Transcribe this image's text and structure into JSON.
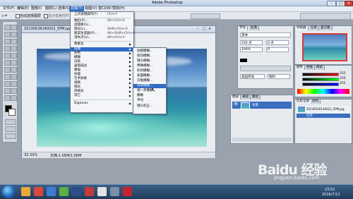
{
  "window": {
    "title": "Adobe Photoshop"
  },
  "menubar": {
    "items": [
      "文件(F)",
      "编辑(E)",
      "图像(I)",
      "图层(L)",
      "选择(S)",
      "滤镜(T)",
      "视图(V)",
      "窗口(W)",
      "帮助(H)"
    ]
  },
  "optionsbar": {
    "auto_select_label": "自动选择图层",
    "show_transform": "显示变换控件"
  },
  "document": {
    "title": "20130526140022_5PM.jpg @ 33.3% (RGB/8)",
    "zoom": "33.33%",
    "doc_info": "文档:1.05M/1.05M"
  },
  "filter_menu": {
    "items": [
      {
        "label": "上次滤镜操作(F)",
        "shortcut": "Ctrl+F"
      },
      {
        "label": "抽出(X)...",
        "shortcut": "Alt+Ctrl+X"
      },
      {
        "label": "滤镜库(G)...",
        "shortcut": ""
      },
      {
        "label": "液化(L)...",
        "shortcut": "Shift+Ctrl+X"
      },
      {
        "label": "图案生成器(P)...",
        "shortcut": "Alt+Shift+Ctrl+X"
      },
      {
        "label": "消失点(V)...",
        "shortcut": "Alt+Ctrl+V"
      },
      {
        "label": "像素化",
        "shortcut": ""
      },
      {
        "label": "扭曲",
        "shortcut": ""
      },
      {
        "label": "杂色",
        "shortcut": ""
      },
      {
        "label": "模糊",
        "shortcut": ""
      },
      {
        "label": "渲染",
        "shortcut": ""
      },
      {
        "label": "画笔描边",
        "shortcut": ""
      },
      {
        "label": "素描",
        "shortcut": ""
      },
      {
        "label": "纹理",
        "shortcut": ""
      },
      {
        "label": "艺术效果",
        "shortcut": ""
      },
      {
        "label": "视频",
        "shortcut": ""
      },
      {
        "label": "锐化",
        "shortcut": ""
      },
      {
        "label": "风格化",
        "shortcut": ""
      },
      {
        "label": "其它",
        "shortcut": ""
      },
      {
        "label": "Digimarc",
        "shortcut": ""
      }
    ]
  },
  "submenu": {
    "items": [
      "动感模糊...",
      "径向模糊...",
      "镜头模糊...",
      "特殊模糊...",
      "形状模糊...",
      "表面模糊...",
      "方框模糊...",
      "高斯模糊...",
      "进一步模糊",
      "模糊",
      "平均",
      "镜头校正..."
    ]
  },
  "panels": {
    "character_tabs": [
      "字符",
      "段落"
    ],
    "char_font": "黑体",
    "char_size": "100 点",
    "char_scale": "100%",
    "char_track": "0",
    "char_leading": "0 点",
    "char_lang": "美国英语",
    "char_aa": "锐利",
    "navigator_tabs": [
      "导航器",
      "信息",
      "直方图"
    ],
    "color_tabs": [
      "颜色",
      "色板",
      "样式"
    ],
    "color_values": [
      "255",
      "255",
      "255"
    ],
    "layers_tabs": [
      "图层",
      "通道",
      "路径"
    ],
    "layer_name": "背景",
    "history_tabs": [
      "历史记录",
      "动作"
    ],
    "history_items": [
      "20130526140022_5PM.jpg",
      "打开"
    ]
  },
  "watermark": {
    "brand": "Baidu 经验",
    "url": "jingyan.baidu.com"
  },
  "taskbar": {
    "time": "23:51",
    "date": "2016/7/11"
  }
}
